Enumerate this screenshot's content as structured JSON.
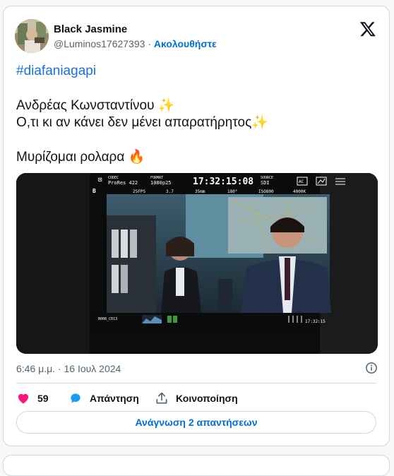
{
  "tweet": {
    "author_name": "Black Jasmine",
    "handle": "@Luminos17627393",
    "separator": "·",
    "follow_label": "Ακολουθήστε",
    "hashtag": "#diafaniagapi",
    "line1": " Ανδρέας Κωνσταντίνου ✨",
    "line2": "Ο,τι κι αν κάνει δεν μένει απαρατήρητος✨",
    "line3": "Μυρίζομαι ρολαρα 🔥",
    "timestamp": "6:46 μ.μ. · 16 Ιουλ 2024"
  },
  "actions": {
    "like_count": "59",
    "reply_label": "Απάντηση",
    "share_label": "Κοινοποίηση"
  },
  "read_replies_label": "Ανάγνωση 2 απαντήσεων",
  "monitor": {
    "codec_label": "CODEC",
    "codec": "ProRes 422",
    "format_label": "FORMAT",
    "format": "1080p25",
    "timecode": "17:32:15:08",
    "source_label": "SOURCE",
    "source": "SDI",
    "fps": "25FPS",
    "iris": "3.7",
    "lens": "35mm",
    "shutter": "180°",
    "iso": "ISO800",
    "wb": "4000K",
    "mode": "B",
    "clip": "B008_C013",
    "bottom_tc": "17:32:15",
    "ac_label": "AC"
  },
  "colors": {
    "accent": "#1d9bf0",
    "like": "#f91880",
    "link": "#006fd6"
  }
}
